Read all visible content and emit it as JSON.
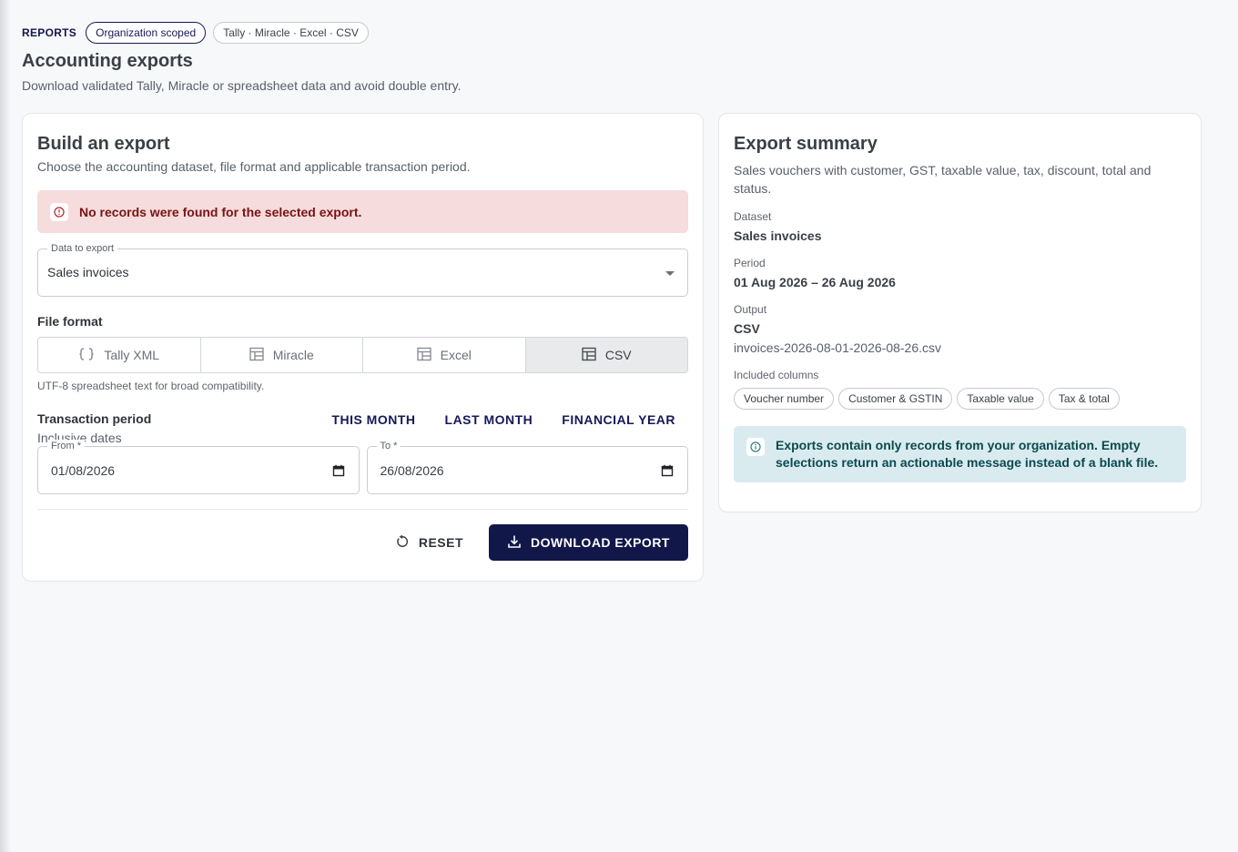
{
  "header": {
    "eyebrow": "REPORTS",
    "chip_scope": "Organization scoped",
    "chip_formats": "Tally · Miracle · Excel · CSV",
    "title": "Accounting exports",
    "subtitle": "Download validated Tally, Miracle or spreadsheet data and avoid double entry."
  },
  "build": {
    "title": "Build an export",
    "subtitle": "Choose the accounting dataset, file format and applicable transaction period.",
    "alert": "No records were found for the selected export.",
    "dataset_label": "Data to export",
    "dataset_value": "Sales invoices",
    "format_label": "File format",
    "formats": [
      {
        "label": "Tally XML",
        "icon": "code-braces-icon"
      },
      {
        "label": "Miracle",
        "icon": "table-icon"
      },
      {
        "label": "Excel",
        "icon": "table-icon"
      },
      {
        "label": "CSV",
        "icon": "table-icon",
        "selected": true
      }
    ],
    "format_hint": "UTF-8 spreadsheet text for broad compatibility.",
    "period_title": "Transaction period",
    "period_sub": "Inclusive dates",
    "quick": [
      "THIS MONTH",
      "LAST MONTH",
      "FINANCIAL YEAR"
    ],
    "from_label": "From *",
    "from_value": "01/08/2026",
    "to_label": "To *",
    "to_value": "26/08/2026",
    "reset_label": "RESET",
    "download_label": "DOWNLOAD EXPORT"
  },
  "summary": {
    "title": "Export summary",
    "description": "Sales vouchers with customer, GST, taxable value, tax, discount, total and status.",
    "dataset_label": "Dataset",
    "dataset_value": "Sales invoices",
    "period_label": "Period",
    "period_value": "01 Aug 2026 – 26 Aug 2026",
    "output_label": "Output",
    "output_value": "CSV",
    "output_file": "invoices-2026-08-01-2026-08-26.csv",
    "columns_label": "Included columns",
    "columns": [
      "Voucher number",
      "Customer & GSTIN",
      "Taxable value",
      "Tax & total"
    ],
    "info": "Exports contain only records from your organization. Empty selections return an actionable message instead of a blank file."
  },
  "colors": {
    "primary": "#12174a",
    "alert_bg": "#f6dcdc",
    "alert_text": "#7a1216",
    "info_bg": "#d9ebee",
    "info_text": "#0c4a4f"
  }
}
